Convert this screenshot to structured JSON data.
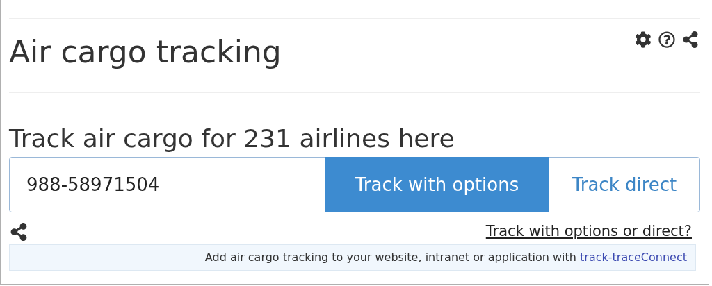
{
  "title": "Air cargo tracking",
  "subtitle": "Track air cargo for 231 airlines here",
  "search": {
    "value": "988-58971504"
  },
  "buttons": [
    {
      "label": "Track with options",
      "selected": true
    },
    {
      "label": "Track direct",
      "selected": false
    }
  ],
  "help_link": "Track with options or direct?",
  "promo": {
    "text": "Add air cargo tracking to your website, intranet or application with ",
    "link": "track-traceConnect"
  }
}
